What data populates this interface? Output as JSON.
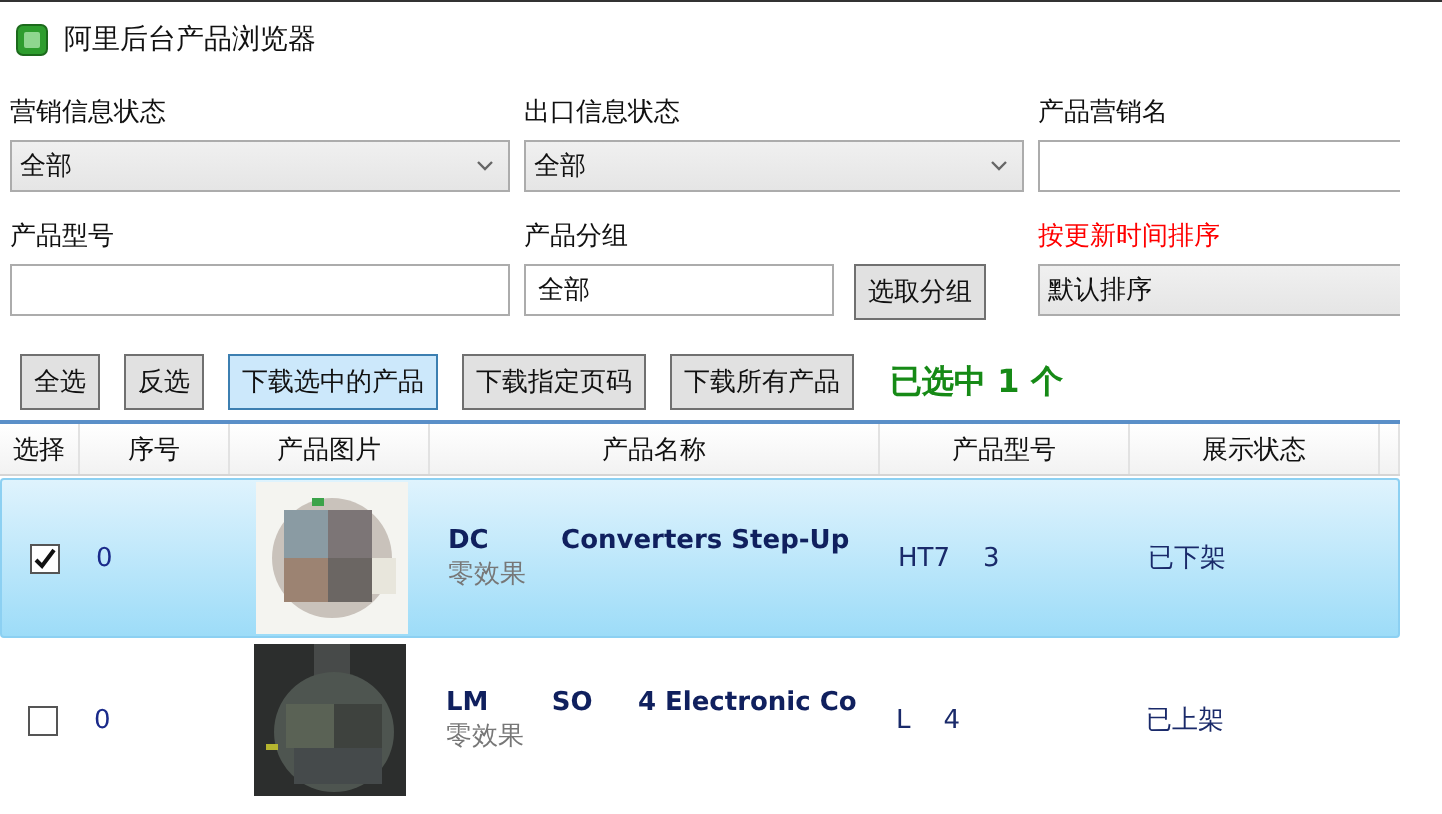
{
  "window": {
    "title": "阿里后台产品浏览器"
  },
  "filters": [
    {
      "kind": "select",
      "label": "营销信息状态",
      "value": "全部"
    },
    {
      "kind": "select",
      "label": "出口信息状态",
      "value": "全部"
    },
    {
      "kind": "input",
      "label": "产品营销名"
    },
    {
      "kind": "input",
      "label": "产品型号"
    },
    {
      "kind": "group",
      "label": "产品分组",
      "value": "全部",
      "button": "选取分组"
    },
    {
      "kind": "sort",
      "label": "按更新时间排序",
      "value": "默认排序"
    }
  ],
  "buttons": [
    {
      "label": "全选",
      "selected": false
    },
    {
      "label": "反选",
      "selected": false
    },
    {
      "label": "下载选中的产品",
      "selected": true
    },
    {
      "label": "下载指定页码",
      "selected": false
    },
    {
      "label": "下载所有产品",
      "selected": false
    }
  ],
  "selection_count": "已选中 1 个",
  "table": {
    "columns": [
      "选择",
      "序号",
      "产品图片",
      "产品名称",
      "产品型号",
      "展示状态"
    ],
    "rows": [
      {
        "selected": true,
        "checked": true,
        "index": "0",
        "name": "DC        Converters Step-Up",
        "subtitle": "零效果",
        "model": "HT7    3",
        "status": "已下架"
      },
      {
        "selected": false,
        "checked": false,
        "index": "0",
        "name": "LM       SO     4 Electronic Co",
        "subtitle": "零效果",
        "model": "L    4",
        "status": "已上架"
      }
    ]
  }
}
